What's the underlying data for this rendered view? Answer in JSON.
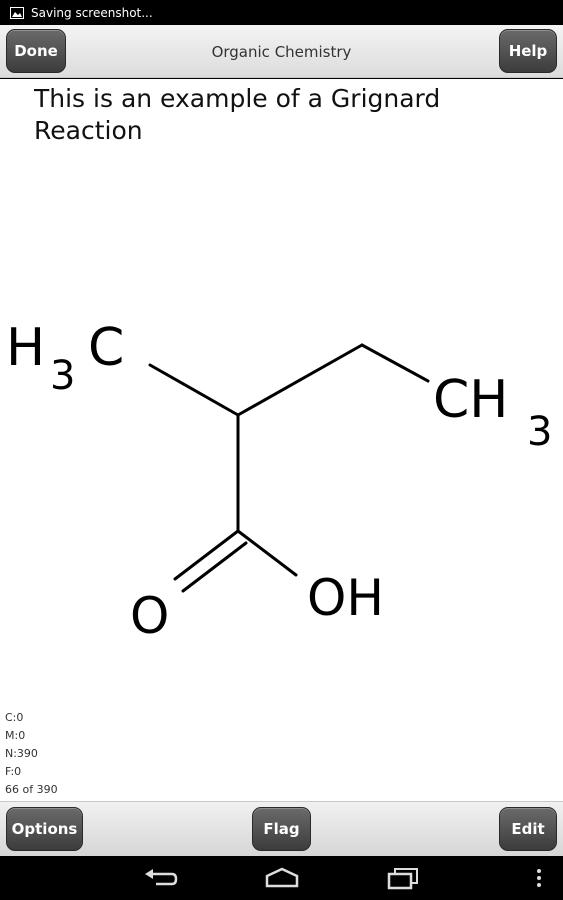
{
  "status_bar": {
    "notification_text": "Saving screenshot...",
    "notification_icon": "image-icon"
  },
  "top_bar": {
    "done_label": "Done",
    "title": "Organic Chemistry",
    "help_label": "Help"
  },
  "card": {
    "text": "This is an example of a Grignard Reaction",
    "structure_labels": {
      "left_methyl": "H",
      "left_methyl_sub": "3",
      "left_methyl_c": "C",
      "right_methyl": "CH",
      "right_methyl_sub": "3",
      "carbonyl_o": "O",
      "hydroxyl": "OH"
    }
  },
  "stats": {
    "c": "C:0",
    "m": "M:0",
    "n": "N:390",
    "f": "F:0",
    "progress": "66 of 390"
  },
  "bottom_bar": {
    "options_label": "Options",
    "flag_label": "Flag",
    "edit_label": "Edit"
  },
  "nav_bar": {
    "icons": [
      "back-icon",
      "home-icon",
      "recent-apps-icon",
      "overflow-menu-icon"
    ]
  },
  "colors": {
    "button_dark": "#4a4a4a",
    "bar_light": "#e6e6e6",
    "text": "#111111"
  }
}
